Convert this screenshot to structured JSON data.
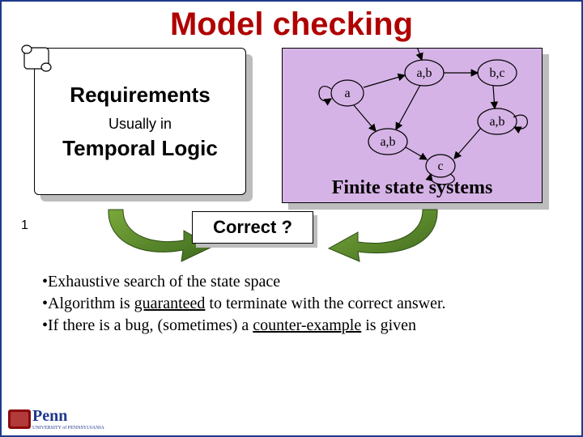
{
  "title": "Model checking",
  "requirements": {
    "heading": "Requirements",
    "sub": "Usually in",
    "main": "Temporal Logic"
  },
  "fsm": {
    "caption": "Finite state systems",
    "nodes": {
      "n1": "a",
      "n2": "a,b",
      "n3": "b,c",
      "n4": "a,b",
      "n5": "a,b",
      "n6": "c"
    }
  },
  "correct": "Correct ?",
  "bullets": {
    "b1_pre": "•Exhaustive search of the state space",
    "b2_pre": "•Algorithm is ",
    "b2_u": "guaranteed",
    "b2_post": " to terminate with the correct answer.",
    "b3_pre": "•If there is a bug, (sometimes) a ",
    "b3_u": "counter-example",
    "b3_post": " is given"
  },
  "slide_number": "1",
  "logo": {
    "text": "Penn",
    "sub": "UNIVERSITY of PENNSYLVANIA"
  }
}
